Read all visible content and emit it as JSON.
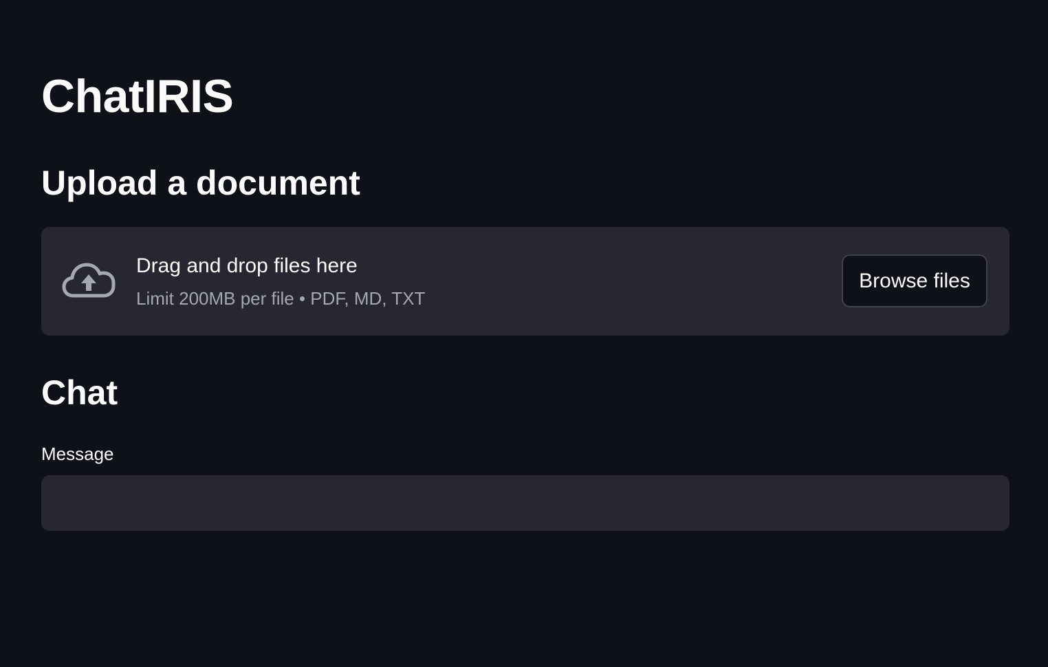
{
  "app": {
    "title": "ChatIRIS"
  },
  "upload": {
    "heading": "Upload a document",
    "icon": "cloud-upload-icon",
    "dropzone_text": "Drag and drop files here",
    "limit_text": "Limit 200MB per file • PDF, MD, TXT",
    "browse_label": "Browse files"
  },
  "chat": {
    "heading": "Chat",
    "message_label": "Message",
    "message_value": "",
    "message_placeholder": ""
  },
  "colors": {
    "background": "#0e1117",
    "surface": "#262730",
    "text": "#fafafa",
    "muted_text": "#a3a8b4",
    "button_border": "#41434c"
  }
}
